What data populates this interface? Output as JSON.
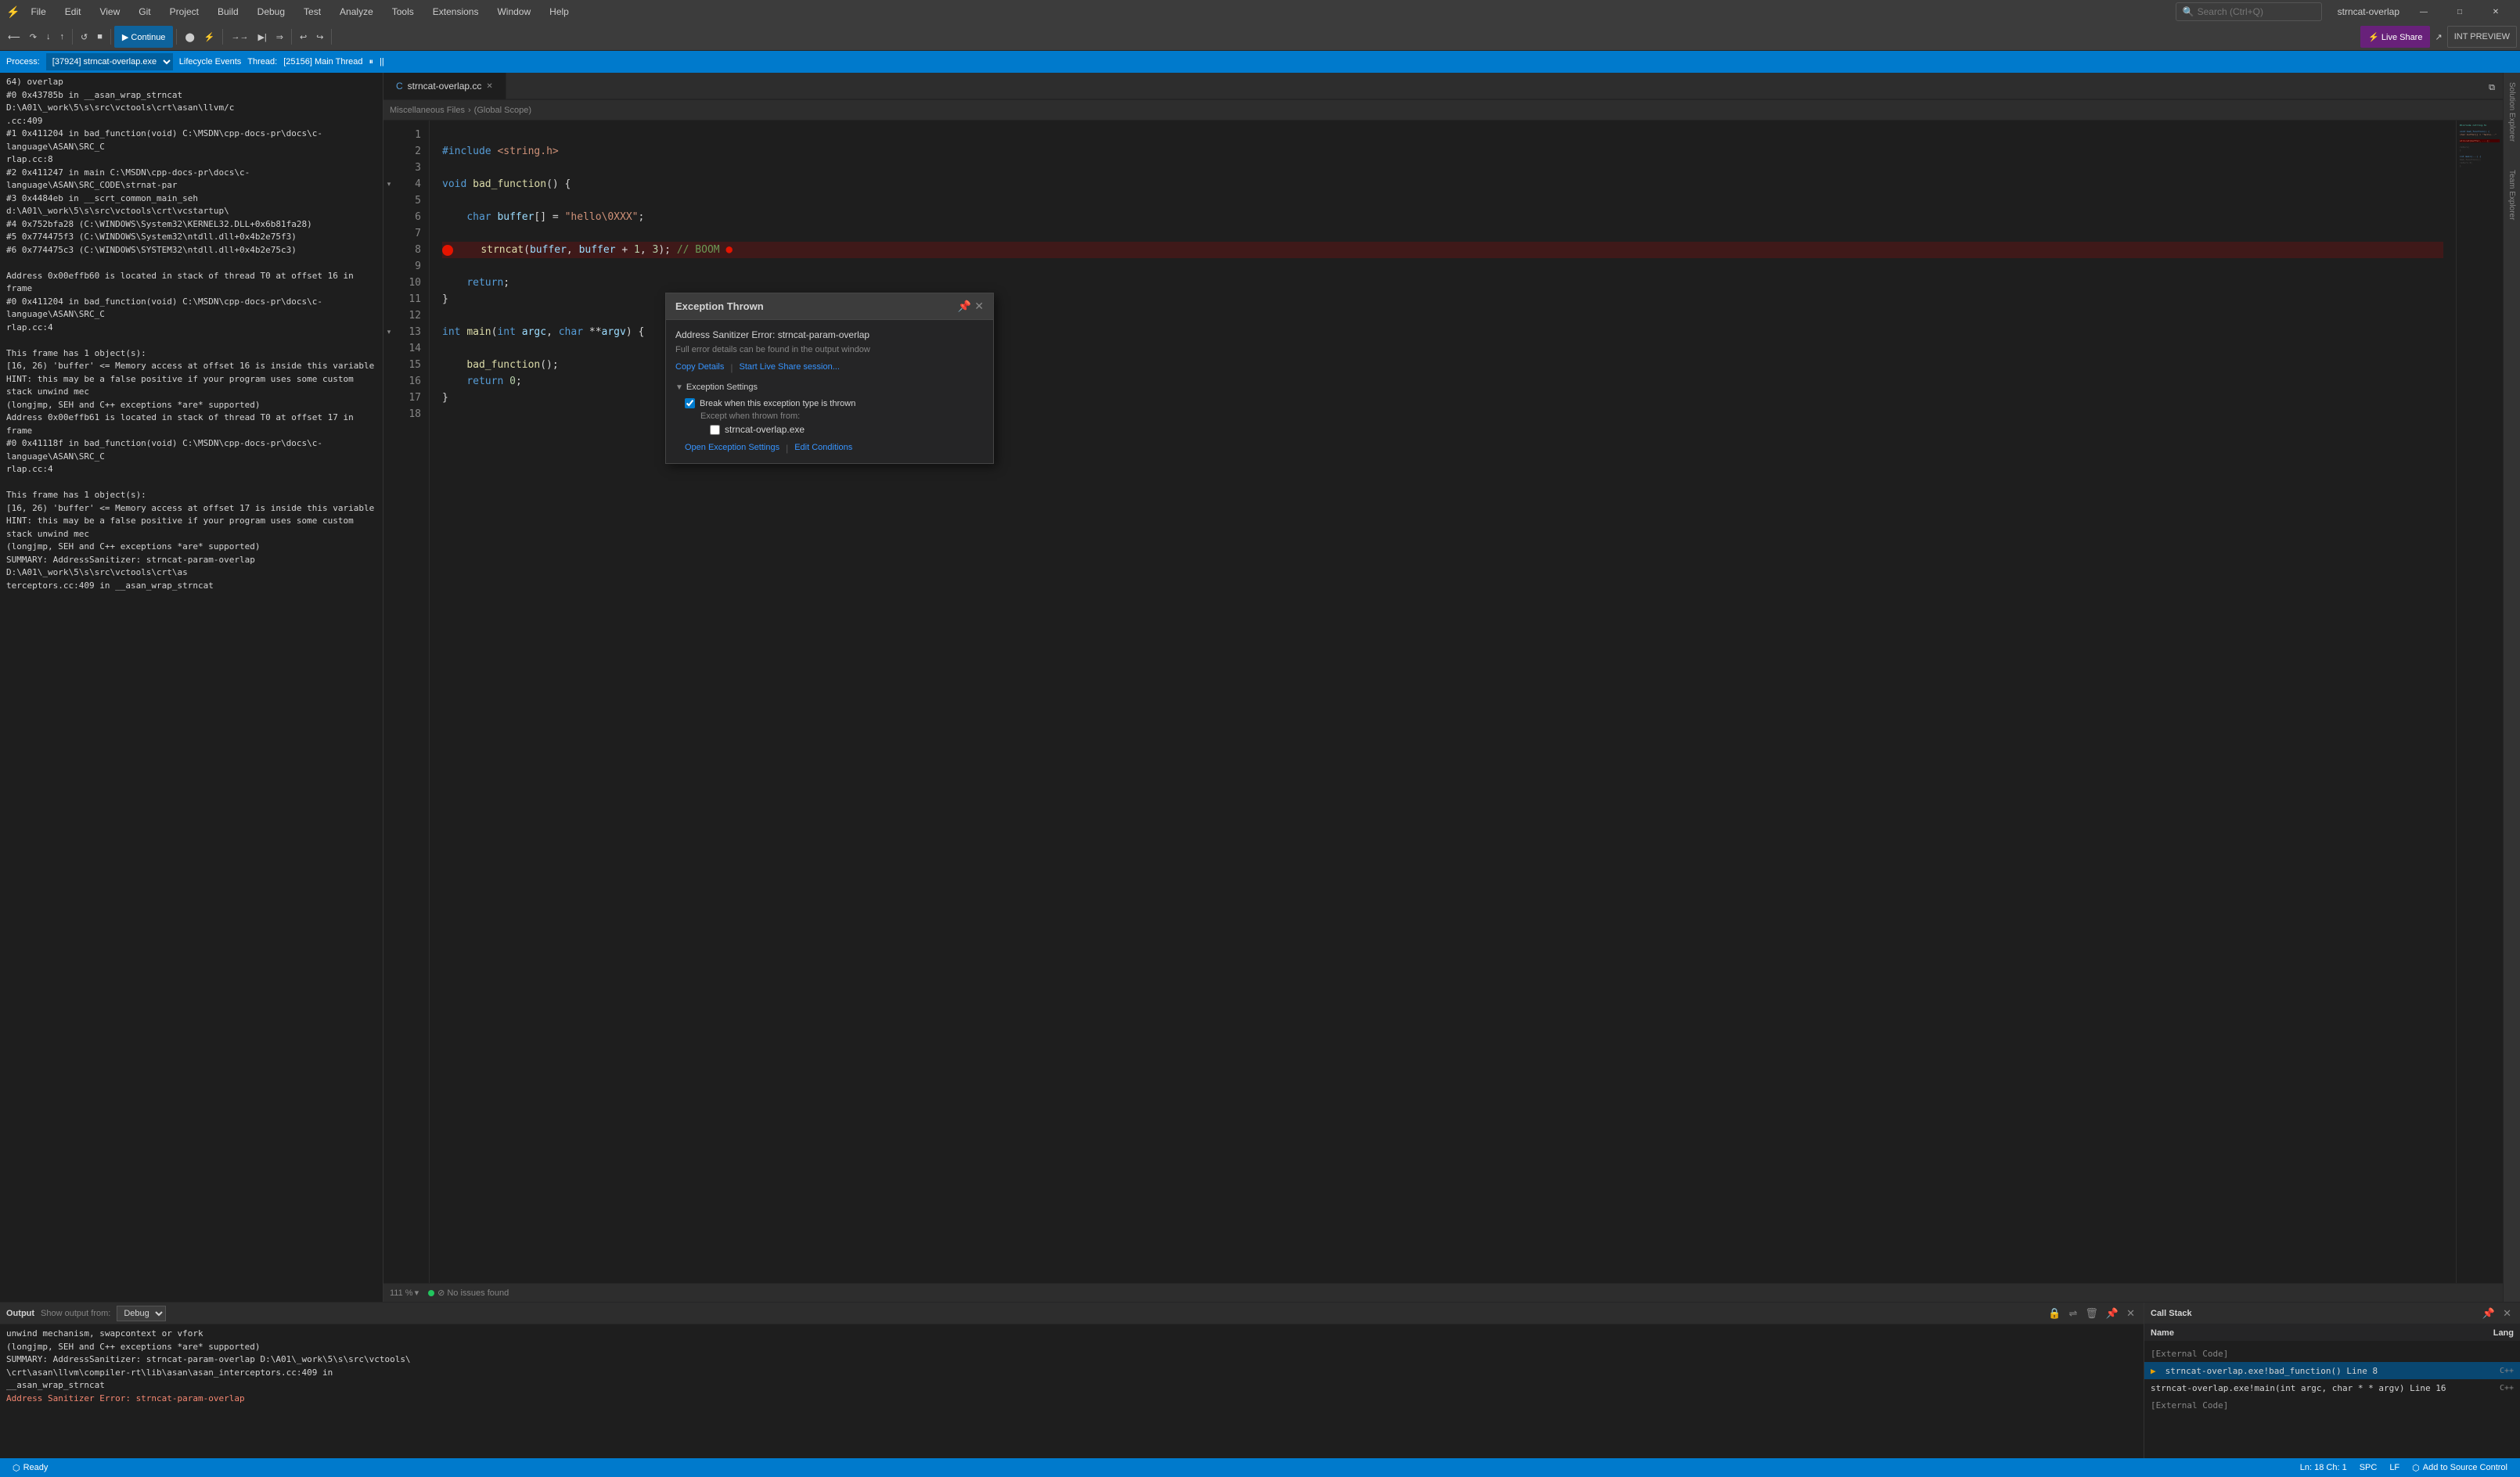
{
  "titleBar": {
    "icon": "⚡",
    "menus": [
      "File",
      "Edit",
      "View",
      "Git",
      "Project",
      "Build",
      "Debug",
      "Test",
      "Analyze",
      "Tools",
      "Extensions",
      "Window",
      "Help"
    ],
    "search": "Search (Ctrl+Q)",
    "title": "strncat-overlap",
    "controls": [
      "—",
      "□",
      "✕"
    ]
  },
  "toolbar": {
    "continueLabel": "▶ Continue",
    "liveShareLabel": "⚡ Live Share",
    "intPreviewLabel": "INT PREVIEW"
  },
  "processBar": {
    "processLabel": "Process:",
    "processValue": "[37924] strncat-overlap.exe",
    "lifecycleLabel": "Lifecycle Events",
    "threadLabel": "Thread:",
    "threadValue": "[25156] Main Thread"
  },
  "tabs": [
    {
      "label": "strncat-overlap.cc",
      "active": true,
      "modified": false
    }
  ],
  "breadcrumb": {
    "left": "Miscellaneous Files",
    "right": "(Global Scope)"
  },
  "codeLines": [
    {
      "num": 1,
      "content": "",
      "type": "empty"
    },
    {
      "num": 2,
      "content": "#include <string.h>",
      "type": "include"
    },
    {
      "num": 3,
      "content": "",
      "type": "empty"
    },
    {
      "num": 4,
      "content": "void bad_function() {",
      "type": "code",
      "fold": true
    },
    {
      "num": 5,
      "content": "",
      "type": "empty"
    },
    {
      "num": 6,
      "content": "    char buffer[] = \"hello\\0XXX\";",
      "type": "code"
    },
    {
      "num": 7,
      "content": "",
      "type": "empty"
    },
    {
      "num": 8,
      "content": "    strncat(buffer, buffer + 1, 3); // BOOM",
      "type": "code",
      "breakpoint": true,
      "error": true
    },
    {
      "num": 9,
      "content": "",
      "type": "empty"
    },
    {
      "num": 10,
      "content": "    return;",
      "type": "code"
    },
    {
      "num": 11,
      "content": "}",
      "type": "code"
    },
    {
      "num": 12,
      "content": "",
      "type": "empty"
    },
    {
      "num": 13,
      "content": "int main(int argc, char **argv) {",
      "type": "code",
      "fold": true
    },
    {
      "num": 14,
      "content": "",
      "type": "empty"
    },
    {
      "num": 15,
      "content": "    bad_function();",
      "type": "code"
    },
    {
      "num": 16,
      "content": "    return 0;",
      "type": "code"
    },
    {
      "num": 17,
      "content": "}",
      "type": "code"
    },
    {
      "num": 18,
      "content": "",
      "type": "empty"
    }
  ],
  "exceptionDialog": {
    "title": "Exception Thrown",
    "errorTitle": "Address Sanitizer Error: strncat-param-overlap",
    "details": "Full error details can be found in the output window",
    "links": {
      "copyDetails": "Copy Details",
      "separator": "|",
      "liveShare": "Start Live Share session..."
    },
    "exceptionSettings": {
      "sectionTitle": "Exception Settings",
      "checkboxLabel": "Break when this exception type is thrown",
      "checked": true,
      "exceptLabel": "Except when thrown from:",
      "exeLabel": "strncat-overlap.exe",
      "exeChecked": false
    },
    "footerLinks": {
      "openSettings": "Open Exception Settings",
      "separator": "|",
      "editConditions": "Edit Conditions"
    }
  },
  "debugConsole": {
    "lines": [
      "64) overlap",
      "   #0 0x43785b in __asan_wrap_strncat D:\\A01\\_work\\5\\s\\src\\vctools\\crt\\asan\\llvm/c",
      "   .cc:409",
      "   #1 0x411204 in bad_function(void) C:\\MSDN\\cpp-docs-pr\\docs\\c-language\\ASAN\\SRC_C",
      "   rlap.cc:8",
      "   #2 0x411247 in main C:\\MSDN\\cpp-docs-pr\\docs\\c-language\\ASAN\\SRC_CODE\\strnat-par",
      "   #3 0x4484eb in __scrt_common_main_seh d:\\A01\\_work\\5\\s\\src\\vctools\\crt\\vcstartup\\",
      "   #4 0x752bfa28  (C:\\WINDOWS\\System32\\KERNEL32.DLL+0x6b81fa28)",
      "   #5 0x774475f3  (C:\\WINDOWS\\System32\\ntdll.dll+0x4b2e75f3)",
      "   #6 0x774475c3  (C:\\WINDOWS\\SYSTEM32\\ntdll.dll+0x4b2e75c3)",
      "",
      "Address 0x00effb60 is located in stack of thread T0 at offset 16 in frame",
      "   #0 0x411204 in bad_function(void) C:\\MSDN\\cpp-docs-pr\\docs\\c-language\\ASAN\\SRC_C",
      "   rlap.cc:4",
      "",
      "  This frame has 1 object(s):",
      "    [16, 26) 'buffer' <= Memory access at offset 16 is inside this variable",
      "Address 0x00effb61 is located in stack of thread T0 at offset 17 in frame",
      "   #0 0x41118f in bad_function(void) C:\\MSDN\\cpp-docs-pr\\docs\\c-language\\ASAN\\SRC_C",
      "   rlap.cc:4",
      "",
      "  This frame has 1 object(s):",
      "    [16, 26) 'buffer' <= Memory access at offset 17 is inside this variable",
      "HINT: this may be a false positive if your program uses some custom stack unwind mec",
      "      (longjmp, SEH and C++ exceptions *are* supported)",
      "SUMMARY: AddressSanitizer: strncat-param-overlap D:\\A01\\_work\\5\\s\\src\\vctools\\crt\\as",
      "terceptors.cc:409 in __asan_wrap_strncat"
    ]
  },
  "outputPanel": {
    "title": "Output",
    "showOutputFrom": "Show output from:",
    "debugOption": "Debug",
    "lines": [
      "    unwind mechanism, swapcontext or vfork",
      "         (longjmp, SEH and C++ exceptions *are* supported)",
      "SUMMARY: AddressSanitizer: strncat-param-overlap D:\\A01\\_work\\5\\s\\src\\vctools\\",
      "   \\crt\\asan\\llvm\\compiler-rt\\lib\\asan\\asan_interceptors.cc:409 in",
      "   __asan_wrap_strncat",
      "Address Sanitizer Error: strncat-param-overlap"
    ]
  },
  "callStackPanel": {
    "title": "Call Stack",
    "columns": [
      "Name",
      "Lang"
    ],
    "items": [
      {
        "name": "[External Code]",
        "lang": "",
        "grayed": true
      },
      {
        "name": "strncat-overlap.exe!bad_function() Line 8",
        "lang": "C++",
        "active": true
      },
      {
        "name": "strncat-overlap.exe!main(int argc, char * * argv) Line 16",
        "lang": "C++",
        "active": false
      },
      {
        "name": "[External Code]",
        "lang": "",
        "grayed": true
      }
    ]
  },
  "statusBar": {
    "ready": "⬡ Ready",
    "lineCol": "Ln: 18  Ch: 1",
    "spaces": "SPC",
    "encoding": "LF",
    "sourceControl": "⬡ Add to Source Control",
    "zoom": "111 %",
    "noIssues": "⊘ No issues found"
  }
}
